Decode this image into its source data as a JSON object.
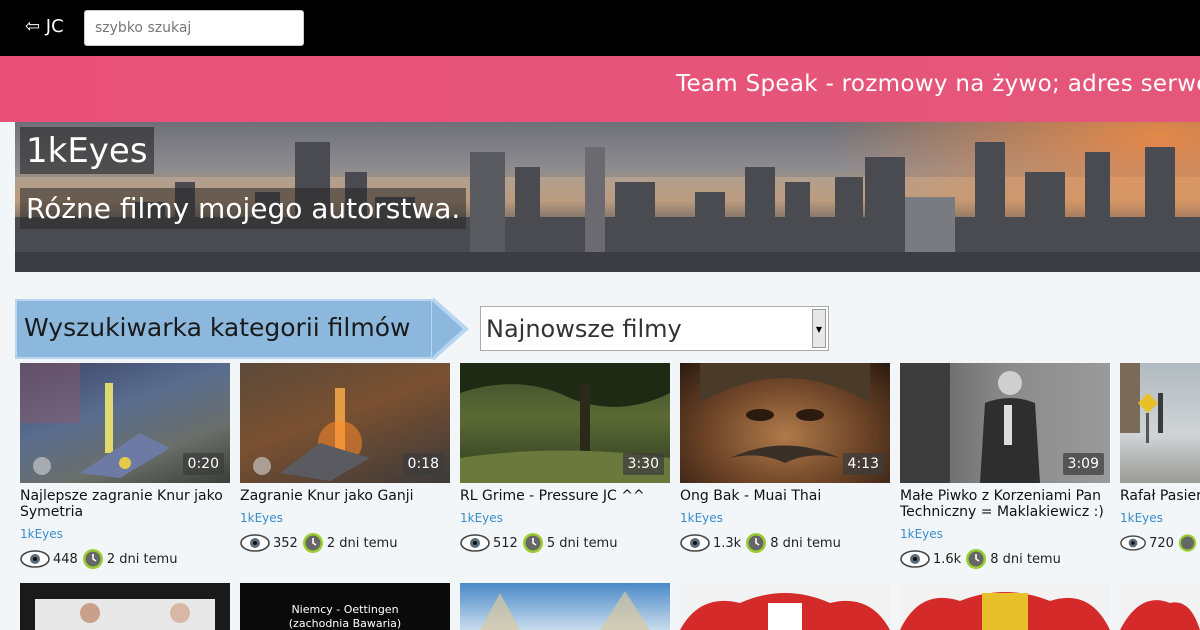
{
  "header": {
    "back_label": "⇦ JC",
    "search_placeholder": "szybko szukaj"
  },
  "ticker": {
    "text": "Team Speak - rozmowy na żywo; adres serwera"
  },
  "hero": {
    "title": "1kEyes",
    "subtitle": "Różne filmy mojego autorstwa."
  },
  "category": {
    "label": "Wyszukiwarka kategorii filmów",
    "selected": "Najnowsze filmy"
  },
  "videos": [
    {
      "title": "Najlepsze zagranie Knur jako Symetria",
      "duration": "0:20",
      "author": "1kEyes",
      "views": "448",
      "age": "2 dni temu"
    },
    {
      "title": "Zagranie Knur jako Ganji",
      "duration": "0:18",
      "author": "1kEyes",
      "views": "352",
      "age": "2 dni temu"
    },
    {
      "title": "RL Grime - Pressure JC ^^",
      "duration": "3:30",
      "author": "1kEyes",
      "views": "512",
      "age": "5 dni temu"
    },
    {
      "title": "Ong Bak - Muai Thai",
      "duration": "4:13",
      "author": "1kEyes",
      "views": "1.3k",
      "age": "8 dni temu"
    },
    {
      "title": "Małe Piwko z Korzeniami Pan Techniczny = Maklakiewicz :)",
      "duration": "3:09",
      "author": "1kEyes",
      "views": "1.6k",
      "age": "8 dni temu"
    },
    {
      "title": "Rafał Pasier",
      "duration": "",
      "author": "1kEyes",
      "views": "720",
      "age": ""
    }
  ],
  "row2": {
    "thumb2_text_line1": "Niemcy - Oettingen",
    "thumb2_text_line2": "(zachodnia Bawaria)"
  },
  "colors": {
    "topbar": "#000000",
    "ticker": "#e8507a",
    "category_box": "#8db8dd",
    "author_link": "#3a8ccc",
    "clock_ring": "#9acd32"
  }
}
